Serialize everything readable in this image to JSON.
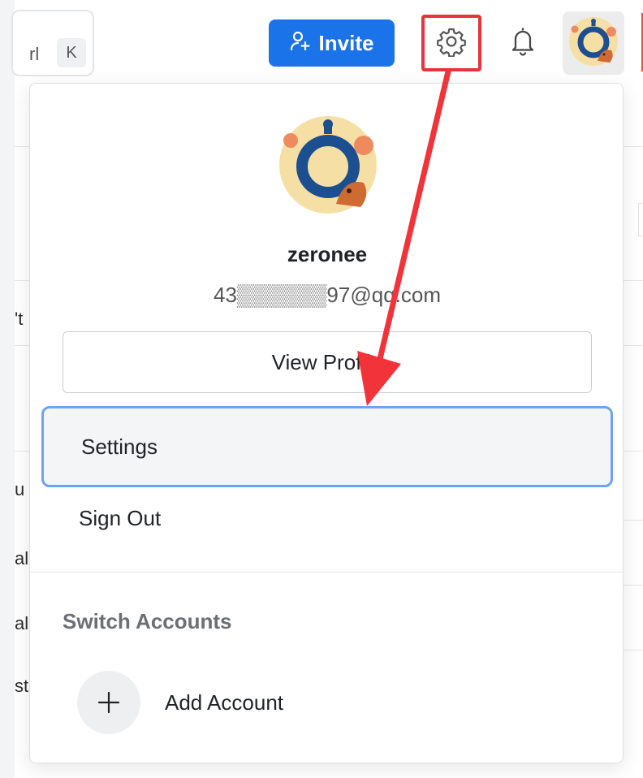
{
  "header": {
    "search_shortcut": {
      "fragment": "rl",
      "key": "K"
    },
    "invite_label": "Invite",
    "icons": [
      "add-user-icon",
      "gear-icon",
      "bell-icon",
      "avatar"
    ]
  },
  "background": {
    "row_fragments": [
      "'t",
      "u",
      "al",
      "al",
      "st"
    ]
  },
  "profile_menu": {
    "username": "zeronee",
    "email": "43▒▒▒▒▒▒97@qq.com",
    "view_profile_label": "View Profile",
    "items": [
      {
        "label": "Settings",
        "highlighted": true
      },
      {
        "label": "Sign Out",
        "highlighted": false
      }
    ],
    "switch_accounts_title": "Switch Accounts",
    "add_account_label": "Add Account"
  },
  "colors": {
    "accent": "#1a73e8",
    "highlight_border": "#e8333a",
    "focus_border": "#6ea4ea",
    "annotation_arrow": "#f2333a"
  }
}
